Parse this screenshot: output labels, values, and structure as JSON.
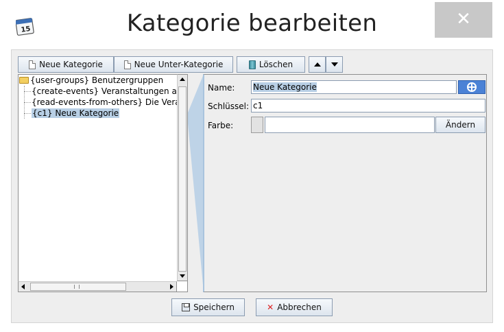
{
  "window": {
    "title": "Kategorie bearbeiten",
    "close_symbol": "✕",
    "app_icon": "calendar-icon",
    "app_icon_text": "15"
  },
  "toolbar": {
    "new_category": "Neue Kategorie",
    "new_subcategory": "Neue Unter-Kategorie",
    "delete": "Löschen"
  },
  "tree": {
    "root": "{user-groups} Benutzergruppen",
    "items": [
      {
        "label": "{create-events} Veranstaltungen anlege"
      },
      {
        "label": "{read-events-from-others} Die Veransta"
      },
      {
        "label": "{c1} Neue Kategorie",
        "selected": true
      }
    ]
  },
  "form": {
    "name_label": "Name:",
    "name_value": "Neue Kategorie",
    "key_label": "Schlüssel:",
    "key_value": "c1",
    "color_label": "Farbe:",
    "color_value": "",
    "change_button": "Ändern"
  },
  "footer": {
    "save": "Speichern",
    "cancel": "Abbrechen"
  },
  "colors": {
    "selection": "#b8cfe5",
    "accent_button": "#4b82d6",
    "close_button": "#c8c8c8"
  }
}
